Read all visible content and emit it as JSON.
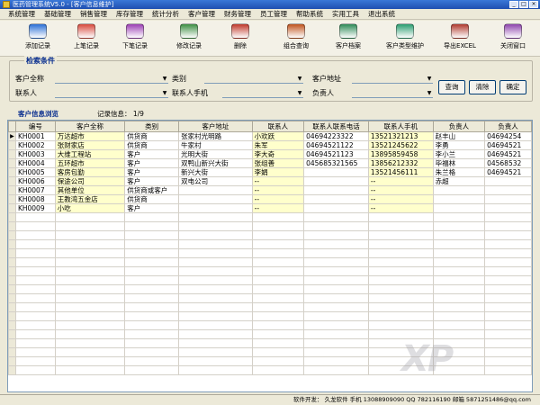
{
  "window": {
    "title": "医药管理系统V5.0 - [客户信息维护]"
  },
  "menu": [
    "系统管理",
    "基础管理",
    "销售管理",
    "库存管理",
    "统计分析",
    "客户管理",
    "财务管理",
    "员工管理",
    "帮助系统",
    "实用工具",
    "退出系统"
  ],
  "toolbar": [
    {
      "label": "添加记录",
      "icon": "add-record-icon",
      "color": "#2b6fd6"
    },
    {
      "label": "上笔记录",
      "icon": "prev-record-icon",
      "color": "#d84a3c"
    },
    {
      "label": "下笔记录",
      "icon": "next-record-icon",
      "color": "#9c3fb4"
    },
    {
      "label": "修改记录",
      "icon": "edit-record-icon",
      "color": "#3c8f42"
    },
    {
      "label": "删除",
      "icon": "delete-icon",
      "color": "#c0392b"
    },
    {
      "label": "组合查询",
      "icon": "combo-query-icon",
      "color": "#c0541e"
    },
    {
      "label": "客户档案",
      "icon": "customer-file-icon",
      "color": "#2e8b57"
    },
    {
      "label": "客户类型维护",
      "icon": "customer-type-icon",
      "color": "#2a9d6f"
    },
    {
      "label": "导出EXCEL",
      "icon": "export-excel-icon",
      "color": "#b03a2e"
    },
    {
      "label": "关闭窗口",
      "icon": "close-window-icon",
      "color": "#8e44ad"
    }
  ],
  "search": {
    "legend": "检索条件",
    "customer_name_label": "客户全称",
    "category_label": "类别",
    "address_label": "客户地址",
    "contact_label": "联系人",
    "contact_phone_label": "联系人手机",
    "owner_label": "负责人",
    "query_button": "查询",
    "clear_button": "清除",
    "confirm_button": "确定"
  },
  "grid": {
    "title": "客户信息浏览",
    "record_info": "记录信息： 1/9",
    "columns": [
      "编号",
      "客户全称",
      "类别",
      "客户地址",
      "联系人",
      "联系人联系电话",
      "联系人手机",
      "负责人",
      "负责人"
    ],
    "rows": [
      [
        "KH0001",
        "万达超市",
        "供货商",
        "张家村光明路",
        "小欢跃",
        "04694223322",
        "13521321213",
        "赵丰山",
        "04694254"
      ],
      [
        "KH0002",
        "张财家店",
        "供货商",
        "牛家村",
        "朱军",
        "04694521122",
        "13521245622",
        "李勇",
        "04694521"
      ],
      [
        "KH0003",
        "大维工程站",
        "客户",
        "光明大街",
        "李大奇",
        "04694521123",
        "13895859458",
        "李小兰",
        "04694521"
      ],
      [
        "KH0004",
        "五环超市",
        "客户",
        "双鸭山新兴大街",
        "张组善",
        "045685321565",
        "13856212332",
        "毕福林",
        "04568532"
      ],
      [
        "KH0005",
        "客房包勤",
        "客户",
        "新兴大街",
        "李娟",
        "",
        "13521456111",
        "朱兰格",
        "04694521"
      ],
      [
        "KH0006",
        "保途公司",
        "客户",
        "双电公司",
        "--",
        "",
        "--",
        "赤超",
        ""
      ],
      [
        "KH0007",
        "其他单位",
        "供货商或客户",
        "",
        "--",
        "",
        "--",
        "",
        ""
      ],
      [
        "KH0008",
        "王教湾五金店",
        "供货商",
        "",
        "--",
        "",
        "--",
        "",
        ""
      ],
      [
        "KH0009",
        "小吃",
        "客户",
        "",
        "--",
        "",
        "--",
        "",
        ""
      ]
    ]
  },
  "status": {
    "text": "软件开发： 久龙软件  手机 13088909090  QQ 782116190  邮箱 5871251486@qq.com"
  },
  "watermark": "XP"
}
